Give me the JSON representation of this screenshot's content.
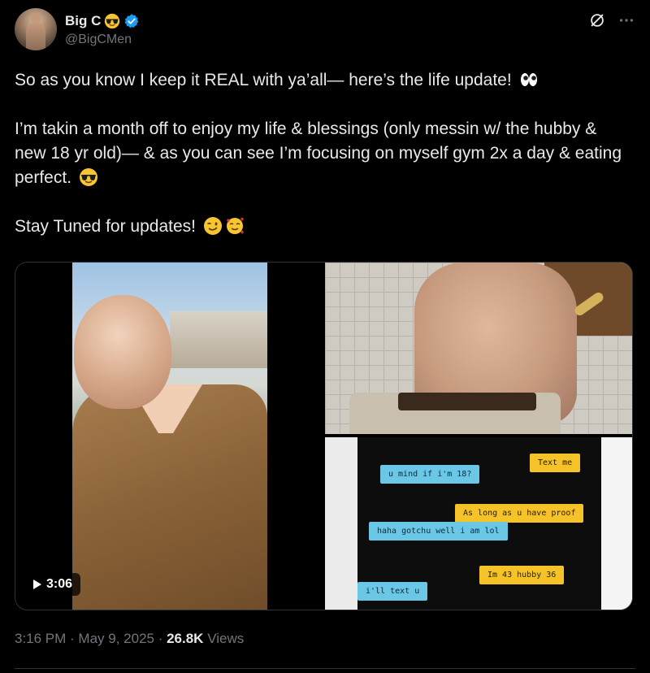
{
  "author": {
    "display_name": "Big C",
    "handle": "@BigCMen",
    "name_emoji": "smiling-face-with-sunglasses",
    "verified": true
  },
  "icons": {
    "grok": "grok-icon",
    "more": "more-dots-icon"
  },
  "tweet": {
    "line1": "So as you know I keep it REAL with ya’all— here’s the life update!",
    "line2": "I’m takin a month off to enjoy my life & blessings (only messin w/ the hubby & new 18 yr old)— & as you can see I’m focusing on myself gym 2x a day & eating perfect.",
    "line3": "Stay Tuned for updates!"
  },
  "media": {
    "video_duration": "3:06",
    "chat_messages": [
      {
        "text": "Text me",
        "side": "right",
        "color": "yellow"
      },
      {
        "text": "u mind if i'm 18?",
        "side": "left",
        "color": "blue"
      },
      {
        "text": "As long as u have proof",
        "side": "right",
        "color": "yellow"
      },
      {
        "text": "haha gotchu well i am lol",
        "side": "left",
        "color": "blue"
      },
      {
        "text": "Im 43 hubby 36",
        "side": "right",
        "color": "yellow"
      },
      {
        "text": "i'll text u",
        "side": "left",
        "color": "blue"
      }
    ]
  },
  "meta": {
    "time": "3:16 PM",
    "sep1": " · ",
    "date": "May 9, 2025",
    "sep2": " · ",
    "views_count": "26.8K",
    "views_label": " Views"
  },
  "colors": {
    "background": "#000000",
    "text": "#e7e9ea",
    "secondary": "#71767b",
    "verified": "#1d9bf0",
    "border": "#2f3336"
  }
}
